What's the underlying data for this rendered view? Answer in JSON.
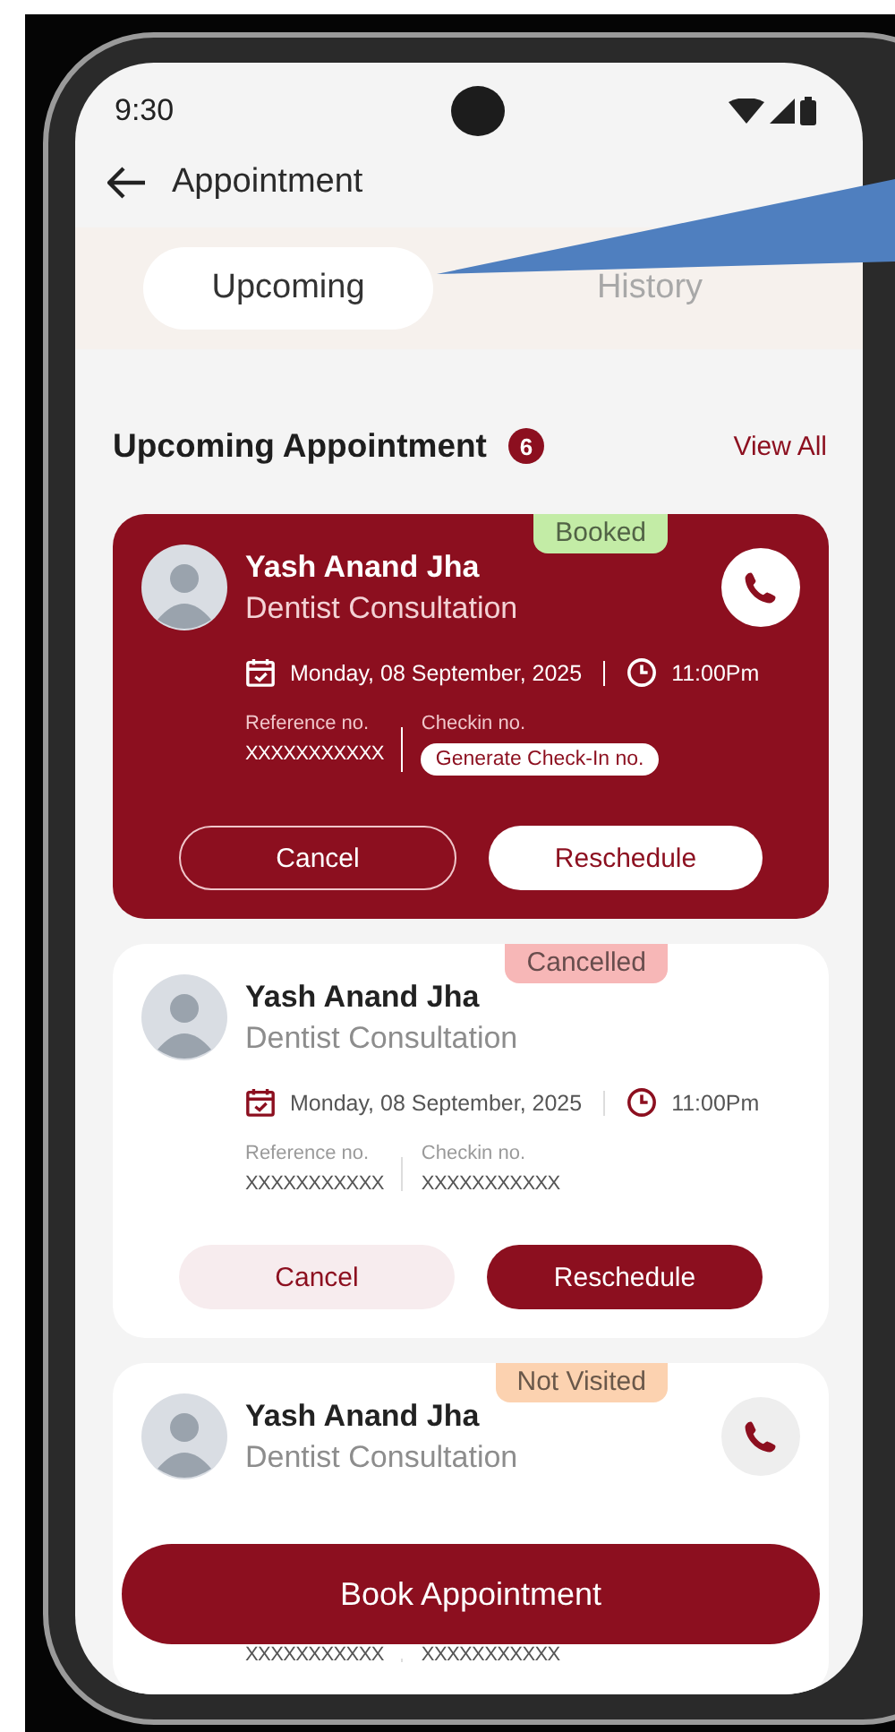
{
  "status_bar": {
    "time": "9:30"
  },
  "header": {
    "title": "Appointment"
  },
  "tabs": [
    {
      "label": "Upcoming",
      "selected": true
    },
    {
      "label": "History",
      "selected": false
    }
  ],
  "section": {
    "title": "Upcoming Appointment",
    "count": "6",
    "link": "View All"
  },
  "appointments": [
    {
      "kind": "featured",
      "status": "Booked",
      "color": "#c3eca6",
      "name": "Yash Anand Jha",
      "service": "Dentist Consultation",
      "call": true,
      "date": "Monday, 08 September, 2025",
      "time": "11:00Pm",
      "reference_label": "Reference no.",
      "reference": "XXXXXXXXXXX",
      "checkin_label": "Checkin no.",
      "checkin_action": "Generate Check-In no.",
      "actions": [
        "Cancel",
        "Reschedule"
      ]
    },
    {
      "kind": "plain",
      "status": "Cancelled",
      "color": "#f7b7b7",
      "name": "Yash Anand Jha",
      "service": "Dentist Consultation",
      "call": false,
      "date": "Monday, 08 September, 2025",
      "time": "11:00Pm",
      "reference_label": "Reference no.",
      "reference": "XXXXXXXXXXX",
      "checkin_label": "Checkin no.",
      "checkin": "XXXXXXXXXXX",
      "actions": [
        "Cancel",
        "Reschedule"
      ]
    },
    {
      "kind": "plain",
      "status": "Not Visited",
      "color": "#fcd2b0",
      "name": "Yash Anand Jha",
      "service": "Dentist Consultation",
      "call": true,
      "reference": "XXXXXXXXXXX",
      "checkin": "XXXXXXXXXXX"
    }
  ],
  "primary_button": "Book Appointment"
}
